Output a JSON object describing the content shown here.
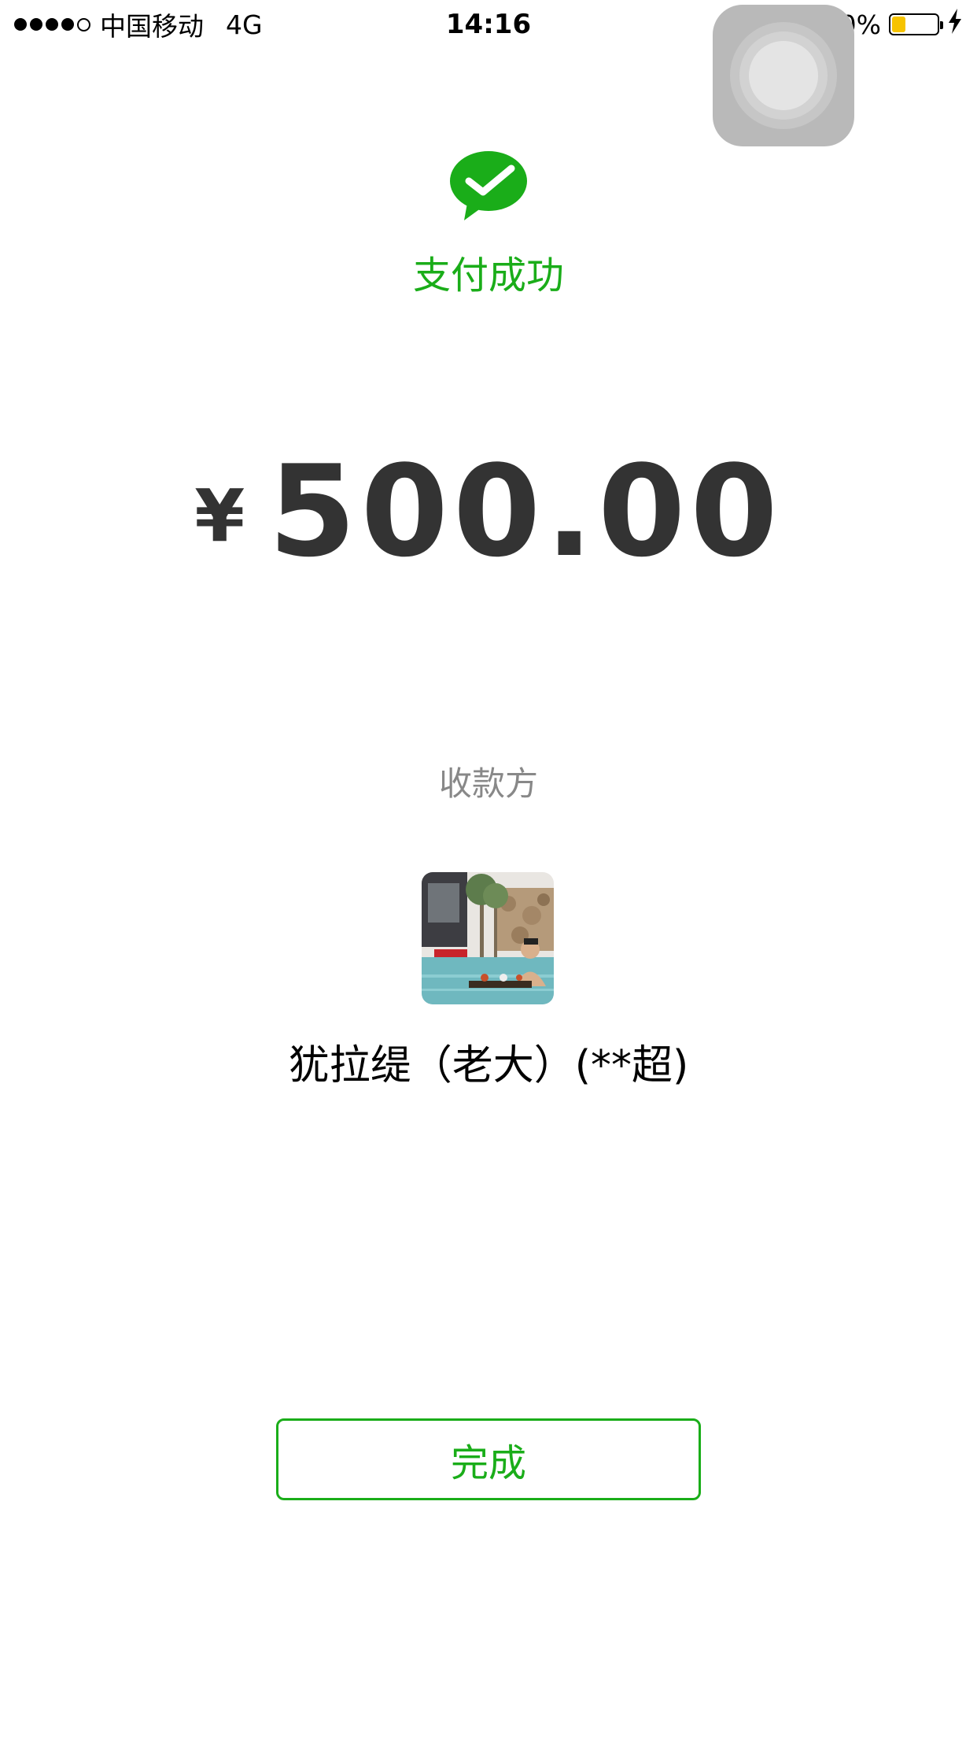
{
  "status_bar": {
    "carrier": "中国移动",
    "network": "4G",
    "time": "14:16",
    "battery_text": "30%",
    "battery_level": 0.3,
    "signal_strength": 4,
    "icons": [
      "orientation-lock-icon",
      "location-arrow-icon",
      "battery-icon",
      "charging-icon"
    ]
  },
  "payment": {
    "status": "支付成功",
    "currency_symbol": "¥",
    "amount": "500.00"
  },
  "payee": {
    "label": "收款方",
    "name": "犹拉缇（老大）(**超)"
  },
  "actions": {
    "done_label": "完成"
  },
  "colors": {
    "brand_green": "#1aad19",
    "amount_text": "#333333",
    "secondary_text": "#888888",
    "battery_fill": "#f6c300"
  }
}
